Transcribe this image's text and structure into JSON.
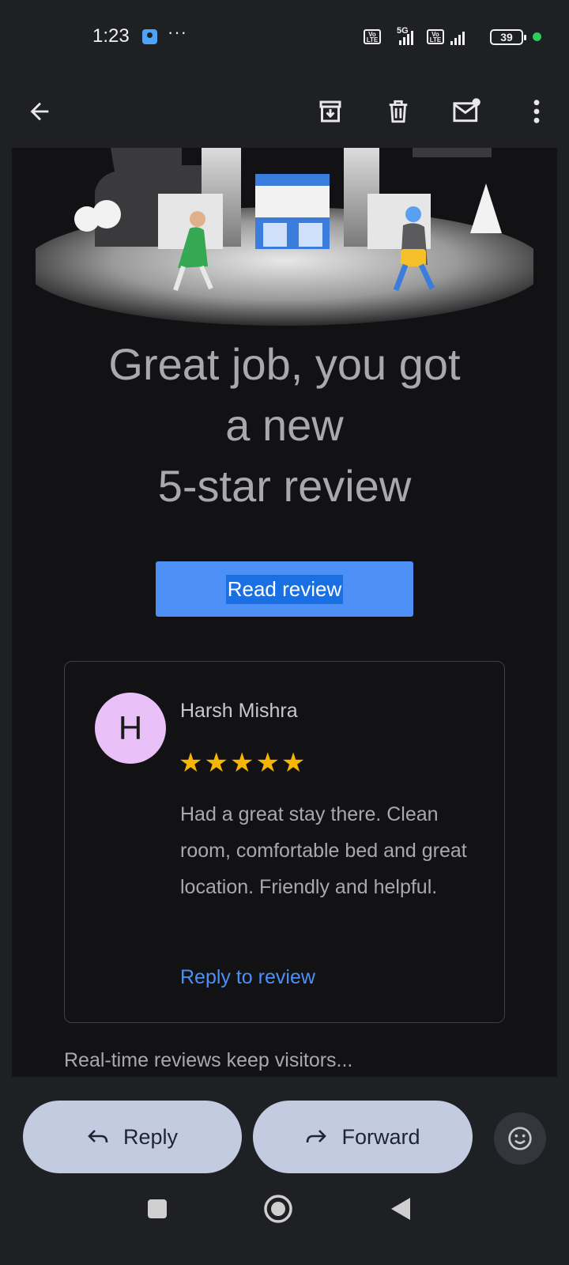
{
  "status_bar": {
    "time": "1:23",
    "more": "···",
    "volte1": "Vo LTE",
    "net": "5G",
    "volte2": "Vo LTE",
    "battery": "39"
  },
  "toolbar": {
    "back_icon": "arrow-left-icon",
    "archive_icon": "archive-icon",
    "delete_icon": "trash-icon",
    "unread_icon": "mark-unread-icon",
    "more_icon": "more-vertical-icon"
  },
  "email": {
    "headline_line1": "Great job, you got",
    "headline_line2": "a new",
    "headline_line3": "5-star review",
    "button_label": "Read review",
    "review": {
      "avatar_letter": "H",
      "reviewer_name": "Harsh Mishra",
      "stars": "★★★★★",
      "rating": 5,
      "text": "Had a great stay there. Clean room, comfortable bed and great location. Friendly and helpful.",
      "reply_link": "Reply to review"
    },
    "cut_off_text": "Real-time reviews keep visitors..."
  },
  "actions": {
    "reply_label": "Reply",
    "forward_label": "Forward",
    "emoji_icon": "emoji-smile-icon"
  },
  "colors": {
    "accent_blue": "#4d8ff5",
    "star": "#f6b500",
    "pill": "#c3cbe1",
    "avatar": "#e9c0f7"
  }
}
